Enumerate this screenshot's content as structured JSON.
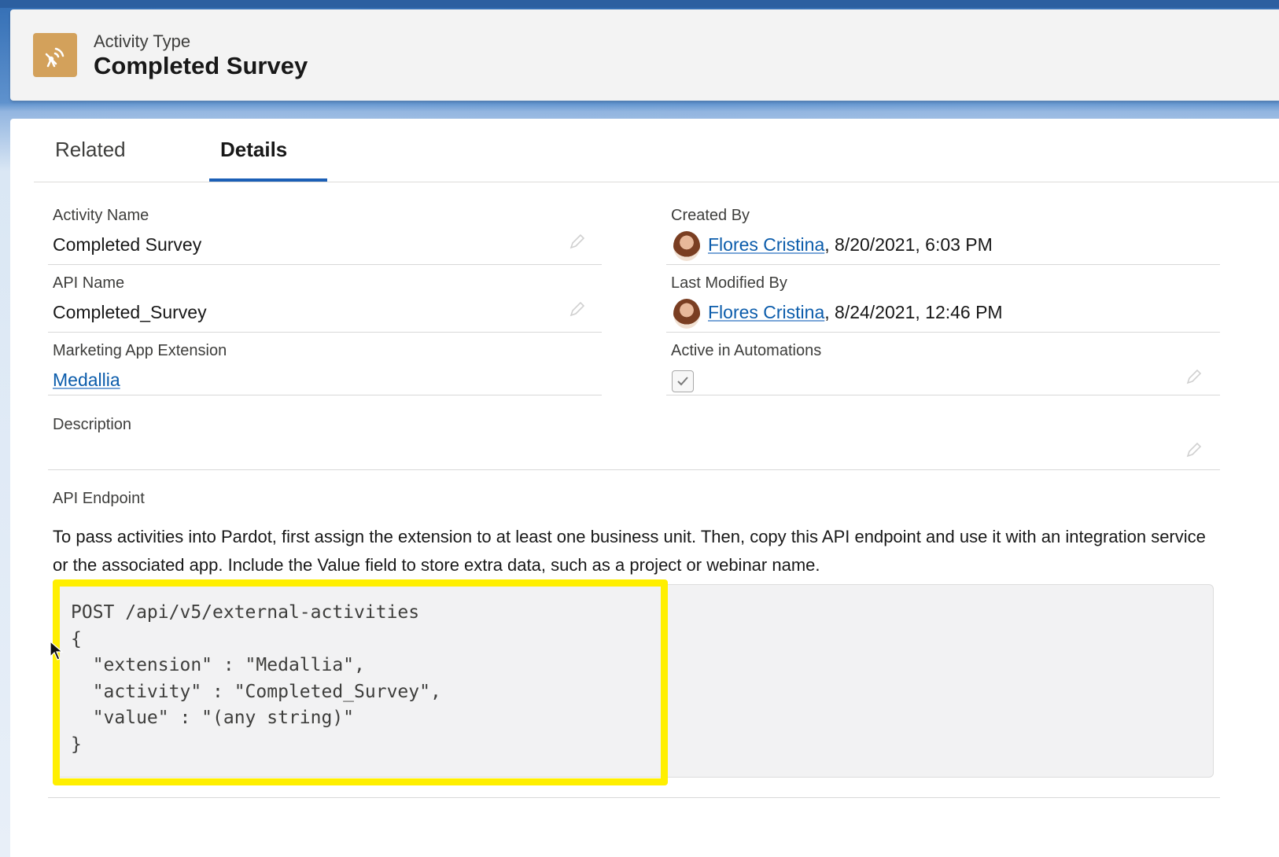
{
  "header": {
    "subtitle": "Activity Type",
    "title": "Completed Survey",
    "icon": "signal-antenna-icon",
    "icon_color": "#d3a15b"
  },
  "tabs": [
    {
      "label": "Related",
      "active": false
    },
    {
      "label": "Details",
      "active": true
    }
  ],
  "fields": {
    "activity_name": {
      "label": "Activity Name",
      "value": "Completed Survey"
    },
    "api_name": {
      "label": "API Name",
      "value": "Completed_Survey"
    },
    "marketing_app_extension": {
      "label": "Marketing App Extension",
      "value": "Medallia"
    },
    "created_by": {
      "label": "Created By",
      "user": "Flores Cristina",
      "date": ", 8/20/2021, 6:03 PM"
    },
    "last_modified_by": {
      "label": "Last Modified By",
      "user": "Flores Cristina",
      "date": ", 8/24/2021, 12:46 PM"
    },
    "active_in_automations": {
      "label": "Active in Automations",
      "checked": true
    },
    "description": {
      "label": "Description",
      "value": ""
    },
    "api_endpoint": {
      "label": "API Endpoint",
      "help_text": "To pass activities into Pardot, first assign the extension to at least one business unit. Then, copy this API endpoint and use it with an integration service or the associated app. Include the Value field to store extra data, such as a project or webinar name.",
      "code": "POST /api/v5/external-activities\n{\n  \"extension\" : \"Medallia\",\n  \"activity\" : \"Completed_Survey\",\n  \"value\" : \"(any string)\"\n}"
    }
  },
  "colors": {
    "accent": "#1b5fb6",
    "link": "#0b5cab",
    "highlight": "#ffef00"
  }
}
